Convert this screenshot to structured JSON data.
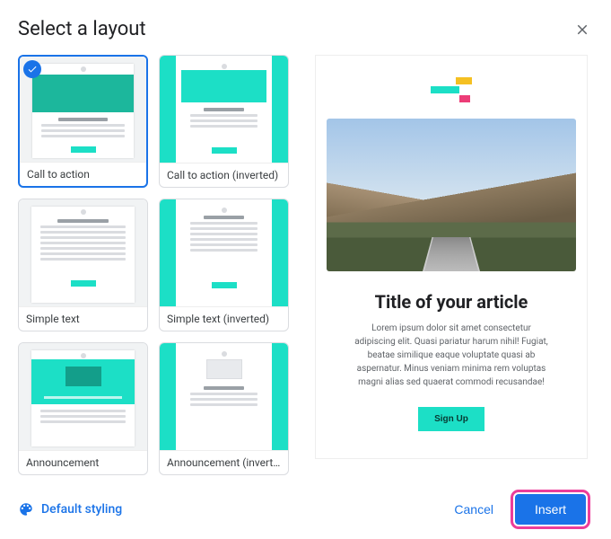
{
  "dialog": {
    "title": "Select a layout"
  },
  "layouts": {
    "items": [
      {
        "label": "Call to action",
        "selected": true
      },
      {
        "label": "Call to action (inverted)",
        "selected": false
      },
      {
        "label": "Simple text",
        "selected": false
      },
      {
        "label": "Simple text (inverted)",
        "selected": false
      },
      {
        "label": "Announcement",
        "selected": false
      },
      {
        "label": "Announcement (inverted)",
        "selected": false
      }
    ]
  },
  "preview": {
    "title": "Title of your article",
    "body": "Lorem ipsum dolor sit amet consectetur adipiscing elit. Quasi pariatur harum nihil! Fugiat, beatae similique eaque voluptate quasi ab aspernatur. Minus veniam minima rem voluptas magni alias sed quaerat commodi recusandae!",
    "cta": "Sign Up"
  },
  "footer": {
    "default_styling": "Default styling",
    "cancel": "Cancel",
    "insert": "Insert"
  }
}
